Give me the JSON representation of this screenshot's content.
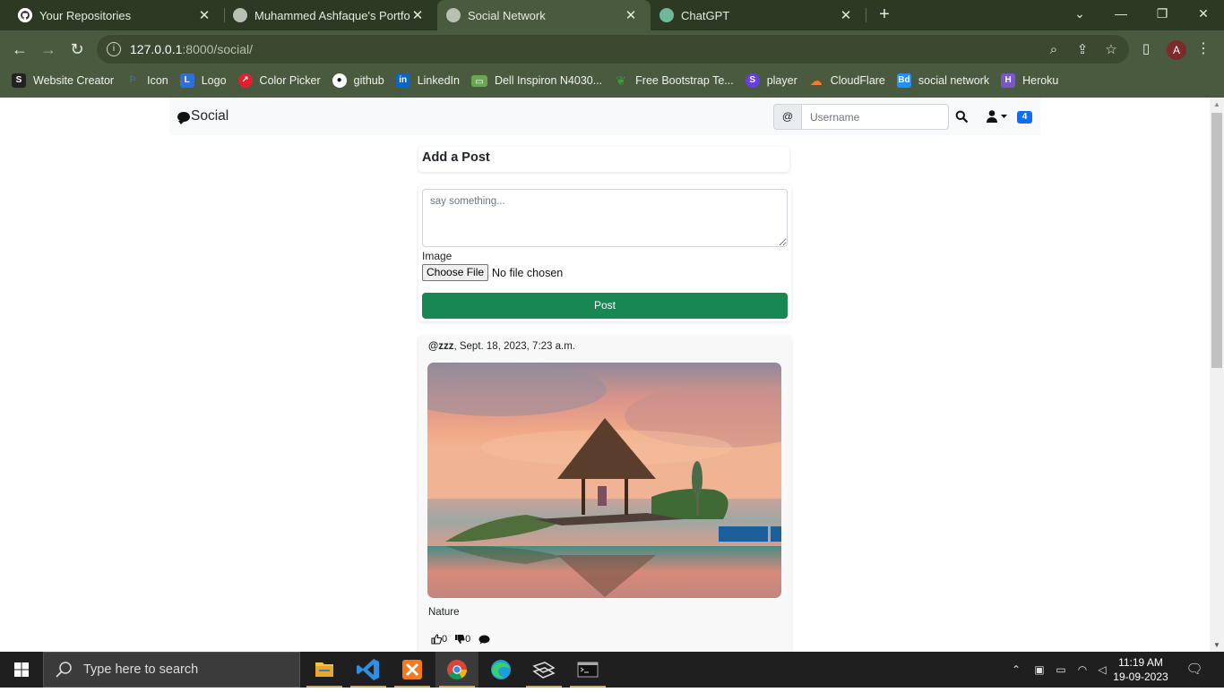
{
  "browser": {
    "tabs": [
      {
        "title": "Your Repositories",
        "icon": "github-icon"
      },
      {
        "title": "Muhammed Ashfaque's Portfolio",
        "icon": "globe-icon"
      },
      {
        "title": "Social Network",
        "icon": "globe-icon",
        "active": true
      },
      {
        "title": "ChatGPT",
        "icon": "chatgpt-icon"
      }
    ],
    "close_glyph": "✕",
    "new_tab_glyph": "+",
    "url_host": "127.0.0.1",
    "url_path": ":8000/social/",
    "profile_initial": "A",
    "bookmarks": [
      {
        "label": "Website Creator",
        "color": "#222222"
      },
      {
        "label": "Icon",
        "color": "#2f6fd6"
      },
      {
        "label": "Logo",
        "color": "#2f6fd6"
      },
      {
        "label": "Color Picker",
        "color": "#e0202e"
      },
      {
        "label": "github",
        "color": "#111111"
      },
      {
        "label": "LinkedIn",
        "color": "#0a66c2"
      },
      {
        "label": "Dell Inspiron N4030...",
        "color": "#6aa84f"
      },
      {
        "label": "Free  Bootstrap Te...",
        "color": "#3d9a3d"
      },
      {
        "label": "player",
        "color": "#6a3de8"
      },
      {
        "label": "CloudFlare",
        "color": "#f38020"
      },
      {
        "label": "social network",
        "color": "#1e90ff"
      },
      {
        "label": "Heroku",
        "color": "#7a57c2"
      }
    ]
  },
  "site": {
    "brand": "Social",
    "search_prefix": "@",
    "search_placeholder": "Username",
    "notification_count": "4",
    "add_post_title": "Add a Post",
    "textarea_placeholder": "say something...",
    "image_label": "Image",
    "file_button": "Choose File",
    "file_status": "No file chosen",
    "post_button": "Post",
    "accent_green": "#198754",
    "accent_blue": "#0d6efd"
  },
  "post": {
    "username": "@zzz",
    "timestamp": ", Sept. 18, 2023, 7:23 a.m.",
    "caption": "Nature",
    "likes": "0",
    "dislikes": "0"
  },
  "taskbar": {
    "search_placeholder": "Type here to search",
    "time": "11:19 AM",
    "date": "19-09-2023"
  }
}
